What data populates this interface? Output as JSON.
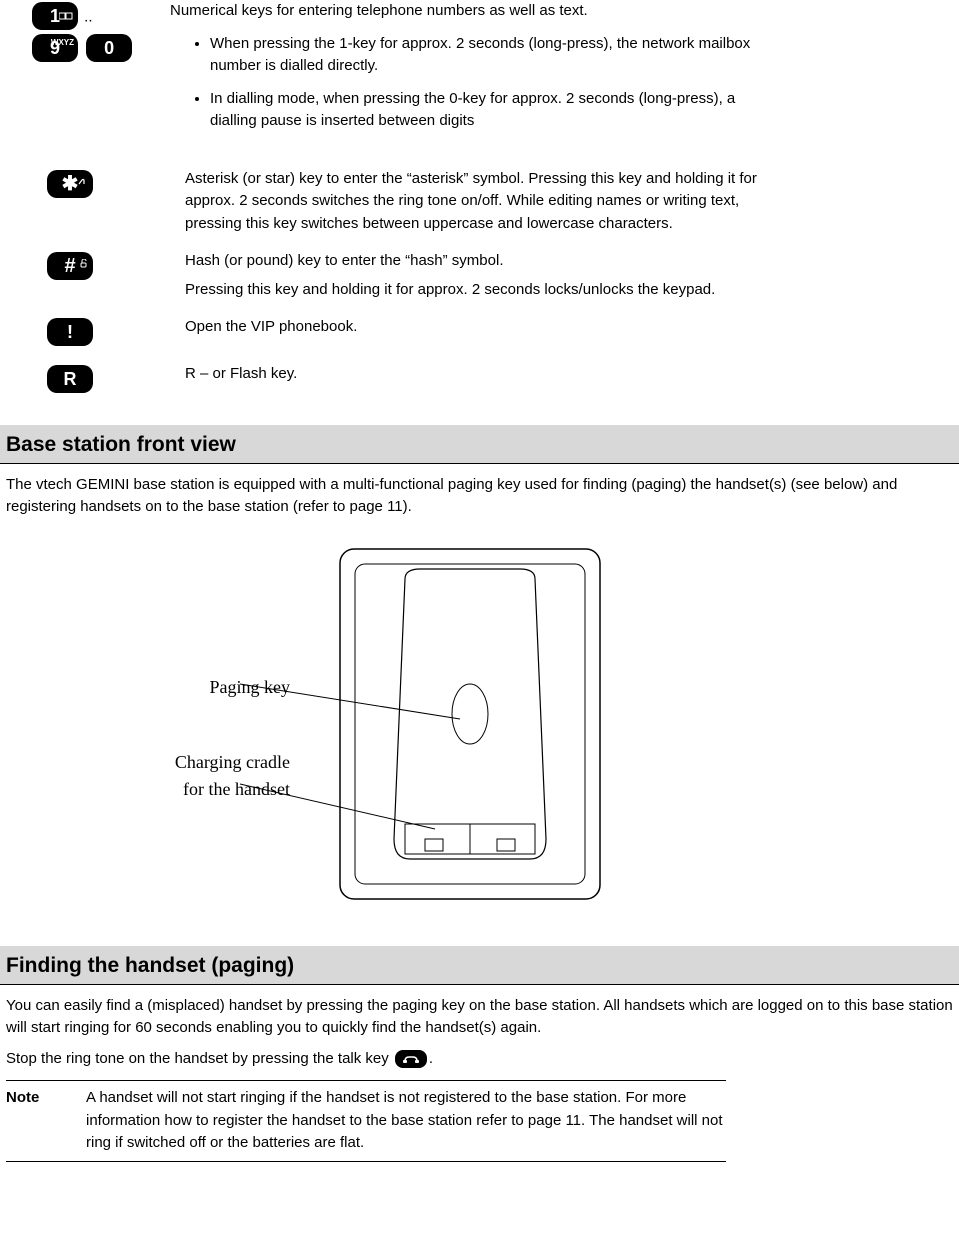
{
  "keys": {
    "num": {
      "intro": "Numerical keys for entering telephone numbers as well as text.",
      "b1": "When pressing the 1-key for approx. 2 seconds (long-press), the network mailbox number is dialled directly.",
      "b2": "In dialling mode, when pressing the 0-key for approx. 2 seconds (long-press), a dialling pause is inserted between digits"
    },
    "star": "Asterisk (or star) key to enter the “asterisk” symbol. Pressing this key and holding it for approx. 2 seconds switches the ring tone on/off. While editing names or writing text, pressing this key switches between uppercase and lowercase characters.",
    "hash1": "Hash (or pound) key to enter the “hash” symbol.",
    "hash2": "Pressing this key and holding it for approx. 2 seconds locks/unlocks the keypad.",
    "vip": "Open the VIP phonebook.",
    "r": "R – or Flash key."
  },
  "base": {
    "heading": "Base station front view",
    "para": "The vtech GEMINI base station is equipped with a multi-functional paging key used for finding (paging) the handset(s) (see below) and registering handsets on to the base station (refer to page 11).",
    "label1": "Paging key",
    "label2a": "Charging cradle",
    "label2b": "for the handset"
  },
  "paging": {
    "heading": "Finding the handset (paging)",
    "p1": "You can easily find a (misplaced) handset by pressing the paging key on the base station. All handsets which are logged on to this base station will start ringing for 60 seconds enabling you to quickly find the handset(s) again.",
    "p2a": "Stop the ring tone on the handset by pressing the talk key ",
    "p2b": ".",
    "noteLabel": "Note",
    "noteText": "A handset will not start ringing if the handset is not registered to the base station. For more information how to register the handset to the base station refer to page 11. The handset will not ring if switched off or the batteries are flat."
  },
  "glyphs": {
    "one": "1",
    "nine": "9",
    "nineSup": "WXYZ",
    "zero": "0",
    "dots": "..",
    "star": "✱",
    "hash": "#",
    "excl": "!",
    "r": "R"
  }
}
